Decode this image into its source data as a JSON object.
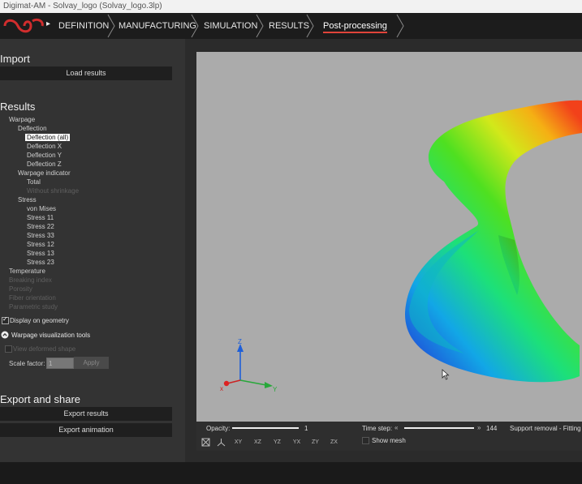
{
  "window": {
    "title": "Digimat-AM - Solvay_logo (Solvay_logo.3lp)"
  },
  "nav": {
    "items": [
      {
        "label": "DEFINITION"
      },
      {
        "label": "MANUFACTURING"
      },
      {
        "label": "SIMULATION"
      },
      {
        "label": "RESULTS"
      },
      {
        "label": "Post-processing"
      }
    ],
    "accent": "#e0443a"
  },
  "sidebar": {
    "import_title": "Import",
    "load_results": "Load results",
    "results_title": "Results",
    "tree": [
      {
        "label": "Warpage",
        "level": 1,
        "state": "normal"
      },
      {
        "label": "Deflection",
        "level": 2,
        "state": "normal"
      },
      {
        "label": "Deflection (all)",
        "level": 3,
        "state": "selected"
      },
      {
        "label": "Deflection X",
        "level": 3,
        "state": "normal"
      },
      {
        "label": "Deflection Y",
        "level": 3,
        "state": "normal"
      },
      {
        "label": "Deflection Z",
        "level": 3,
        "state": "normal"
      },
      {
        "label": "Warpage indicator",
        "level": 2,
        "state": "normal"
      },
      {
        "label": "Total",
        "level": 3,
        "state": "normal"
      },
      {
        "label": "Without shrinkage",
        "level": 3,
        "state": "disabled"
      },
      {
        "label": "Stress",
        "level": 2,
        "state": "normal"
      },
      {
        "label": "von Mises",
        "level": 3,
        "state": "normal"
      },
      {
        "label": "Stress 11",
        "level": 3,
        "state": "normal"
      },
      {
        "label": "Stress 22",
        "level": 3,
        "state": "normal"
      },
      {
        "label": "Stress 33",
        "level": 3,
        "state": "normal"
      },
      {
        "label": "Stress 12",
        "level": 3,
        "state": "normal"
      },
      {
        "label": "Stress 13",
        "level": 3,
        "state": "normal"
      },
      {
        "label": "Stress 23",
        "level": 3,
        "state": "normal"
      },
      {
        "label": "Temperature",
        "level": 1,
        "state": "normal"
      },
      {
        "label": "Breaking index",
        "level": 1,
        "state": "disabled"
      },
      {
        "label": "Porosity",
        "level": 1,
        "state": "disabled"
      },
      {
        "label": "Fiber orientation",
        "level": 1,
        "state": "disabled"
      },
      {
        "label": "Parametric study",
        "level": 1,
        "state": "disabled"
      }
    ],
    "display_on_geometry": "Display on geometry",
    "warpage_tools": "Warpage visualization tools",
    "view_deformed": "View deformed shape",
    "scale_factor_label": "Scale factor:",
    "scale_factor_value": "1",
    "apply": "Apply",
    "export_title": "Export and share",
    "export_results": "Export results",
    "export_animation": "Export animation"
  },
  "viewport": {
    "axis_labels": {
      "x": "x",
      "y": "Y",
      "z": "Z"
    }
  },
  "bottombar": {
    "opacity_label": "Opacity:",
    "opacity_value": "1",
    "opacity_level": 1.0,
    "timestep_label": "Time step:",
    "timestep_value": "144",
    "timestep_level": 1.0,
    "support_removal": "Support removal - Fitting",
    "show_mesh": "Show mesh",
    "tool_icons": [
      "fit-view-icon",
      "axes-icon",
      "view-xy-icon",
      "view-xz-icon",
      "view-yz-icon",
      "view-yx-icon",
      "view-zy-icon",
      "view-zx-icon"
    ],
    "view_labels": [
      "XY",
      "XZ",
      "YZ",
      "YX",
      "ZY",
      "ZX"
    ]
  }
}
